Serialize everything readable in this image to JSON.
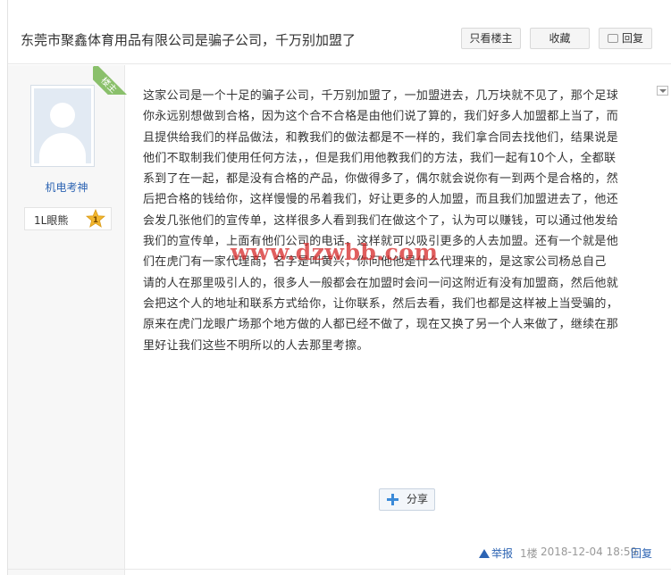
{
  "thread": {
    "title": "东莞市聚鑫体育用品有限公司是骗子公司，千万别加盟了",
    "buttons": {
      "only_owner": "只看楼主",
      "favorite": "收藏",
      "reply": "回复"
    }
  },
  "author": {
    "badge": "楼主",
    "name": "机电考神",
    "level_text": "1L眼熊",
    "level_number": "1",
    "level_badge_color": "#f2b62e"
  },
  "post": {
    "lines": [
      "这家公司是一个十足的骗子公司，千万别加盟了，一加盟进去，几万块就不见了，那个足球",
      "你永远别想做到合格，因为这个合不合格是由他们说了算的，我们好多人加盟都上当了，而",
      "且提供给我们的样品做法，和教我们的做法都是不一样的，我们拿合同去找他们，结果说是",
      "他们不取制我们使用任何方法，，但是我们用他教我们的方法，我们一起有10个人，全都联",
      "系到了在一起，都是没有合格的产品，你做得多了，偶尔就会说你有一到两个是合格的，然",
      "后把合格的钱给你，这样慢慢的吊着我们，好让更多的人加盟，而且我们加盟进去了，他还",
      "会发几张他们的宣传单，这样很多人看到我们在做这个了，认为可以赚钱，可以通过他发给",
      "我们的宣传单，上面有他们公司的电话，这样就可以吸引更多的人去加盟。还有一个就是他",
      "们在虎门有一家代理商，名字是叫黄兴，你问他他是什么代理来的，是这家公司杨总自己",
      "请的人在那里吸引人的，很多人一般都会在加盟时会问一问这附近有没有加盟商，然后他就",
      "会把这个人的地址和联系方式给你，让你联系，然后去看，我们也都是这样被上当受骗的，",
      "原来在虎门龙眼广场那个地方做的人都已经不做了，现在又换了另一个人来做了，继续在那",
      "里好让我们这些不明所以的人去那里考擦。"
    ],
    "watermark": "www.dzwbb.com",
    "share_label": "分享"
  },
  "footer": {
    "report": "举报",
    "floor": "1楼",
    "time": "2018-12-04 18:59",
    "reply": "回复"
  }
}
